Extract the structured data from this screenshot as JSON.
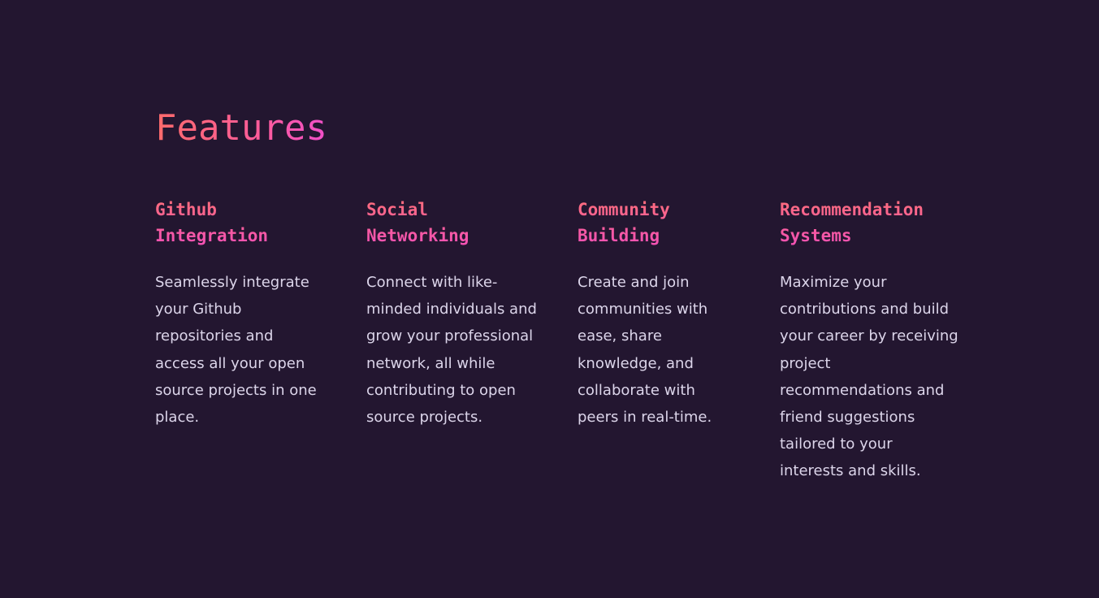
{
  "section": {
    "title": "Features"
  },
  "features": [
    {
      "title_line1": "Github",
      "title_line2": "Integration",
      "description": "Seamlessly integrate your Github repositories and access all your open source projects in one place."
    },
    {
      "title_line1": "Social",
      "title_line2": "Networking",
      "description": "Connect with like-minded individuals and grow your professional network, all while contributing to open source projects."
    },
    {
      "title_line1": "Community",
      "title_line2": "Building",
      "description": "Create and join communities with ease, share knowledge, and collaborate with peers in real-time."
    },
    {
      "title_line1": "Recommendation",
      "title_line2": "Systems",
      "description": "Maximize your contributions and build your career by receiving project recommendations and friend suggestions tailored to your interests and skills."
    }
  ],
  "colors": {
    "background": "#231630",
    "accent_start": "#ff6b6b",
    "accent_end": "#ef4fc9",
    "body_text": "#dcd5ea"
  }
}
